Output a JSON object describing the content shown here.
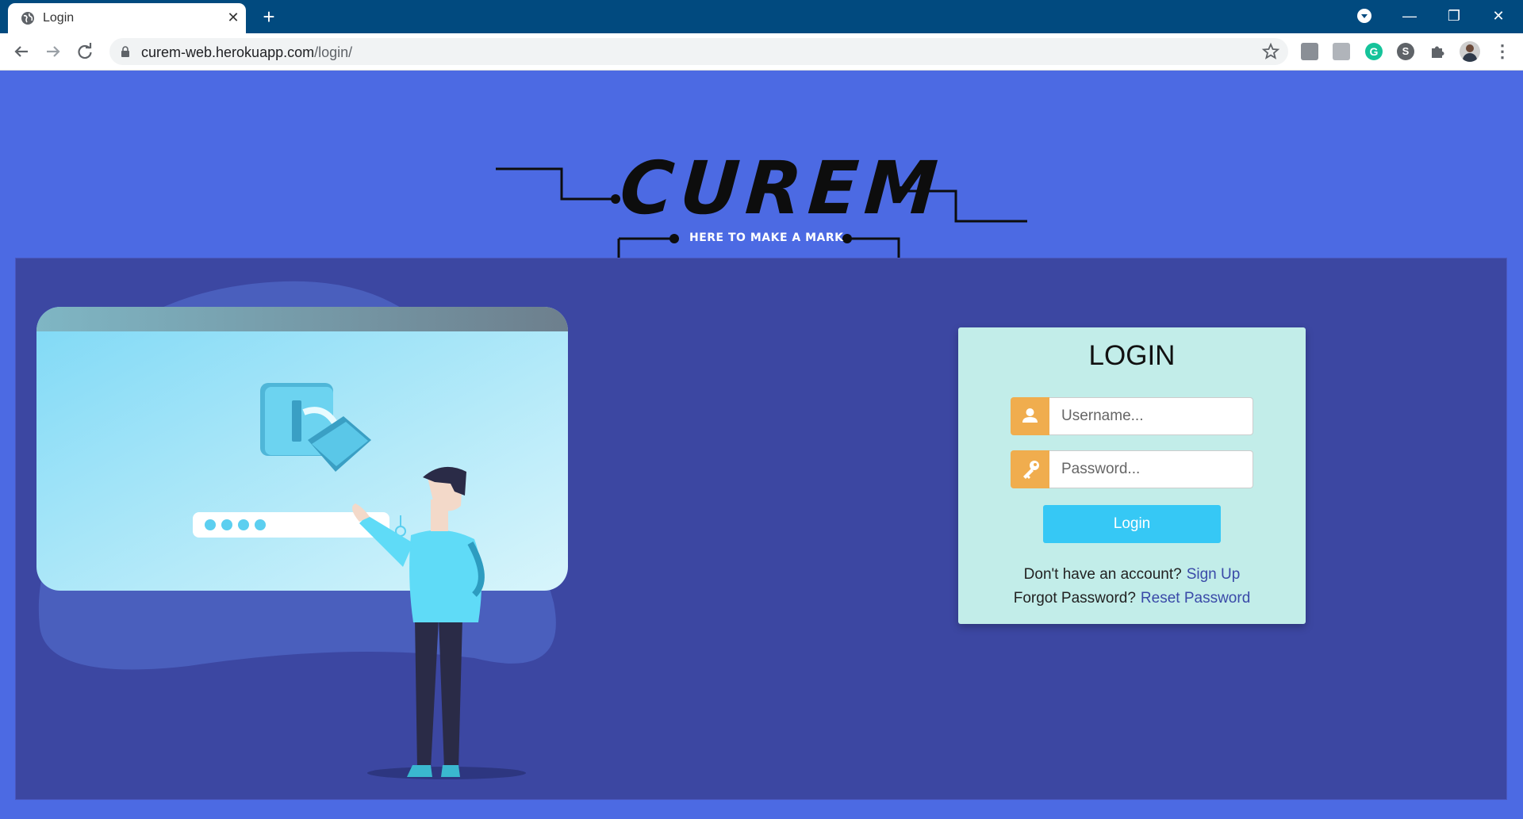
{
  "browser": {
    "tab_title": "Login",
    "url_host": "curem-web.herokuapp.com",
    "url_path": "/login/",
    "extensions": [
      "ext-box-icon",
      "ext-photo-icon",
      "grammarly-icon",
      "s-extension-icon",
      "puzzle-icon"
    ],
    "grammarly_letter": "G",
    "s_letter": "S"
  },
  "logo": {
    "wordmark": "CUREM",
    "tagline": "HERE TO MAKE A MARK"
  },
  "login": {
    "title": "LOGIN",
    "username_placeholder": "Username...",
    "password_placeholder": "Password...",
    "button_label": "Login",
    "signup_prompt": "Don't have an account?",
    "signup_link": "Sign Up",
    "forgot_prompt": "Forgot Password?",
    "reset_link": "Reset Password"
  },
  "colors": {
    "page_bg": "#4c6ae3",
    "panel_bg": "#3c47a2",
    "card_bg": "#c2ede9",
    "icon_addon": "#f0ad4e",
    "button": "#36c8f5",
    "link": "#3a4aa8"
  }
}
